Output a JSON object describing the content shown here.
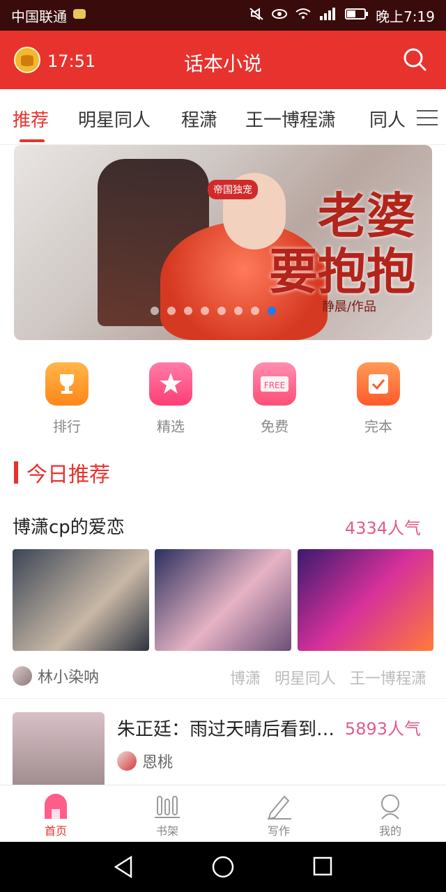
{
  "status": {
    "carrier": "中国联通",
    "time": "晚上7:19"
  },
  "appbar": {
    "timer": "17:51",
    "title": "话本小说"
  },
  "tabs": [
    {
      "label": "推荐",
      "active": true
    },
    {
      "label": "明星同人"
    },
    {
      "label": "程潇"
    },
    {
      "label": "王一博程潇"
    },
    {
      "label": "同人"
    }
  ],
  "banner": {
    "badge": "帝国独宠",
    "title_line1": "老婆",
    "title_line2": "要抱抱",
    "author": "静晨/作品",
    "dots": 8,
    "active_index": 7
  },
  "quick_actions": [
    {
      "label": "排行",
      "icon": "trophy-icon",
      "color": "#ff8f1f"
    },
    {
      "label": "精选",
      "icon": "star-icon",
      "color": "#ff4b82"
    },
    {
      "label": "免费",
      "icon": "free-gift-icon",
      "color": "#ff5a7d"
    },
    {
      "label": "完本",
      "icon": "check-book-icon",
      "color": "#ff6d3b"
    }
  ],
  "section": {
    "title": "今日推荐"
  },
  "card1": {
    "title": "博潇cp的爱恋",
    "popularity": "4334人气",
    "author": "林小染呐",
    "tags": [
      "博潇",
      "明星同人",
      "王一博程潇"
    ]
  },
  "card2": {
    "title": "朱正廷：雨过天晴后看到彩虹",
    "popularity": "5893人气",
    "author": "恩桃"
  },
  "bottom_nav": [
    {
      "label": "首页",
      "icon": "home-icon",
      "active": true
    },
    {
      "label": "书架",
      "icon": "bookshelf-icon"
    },
    {
      "label": "写作",
      "icon": "pen-icon"
    },
    {
      "label": "我的",
      "icon": "profile-icon"
    }
  ],
  "colors": {
    "primary": "#e8322d",
    "popularity": "#e25b8e"
  }
}
